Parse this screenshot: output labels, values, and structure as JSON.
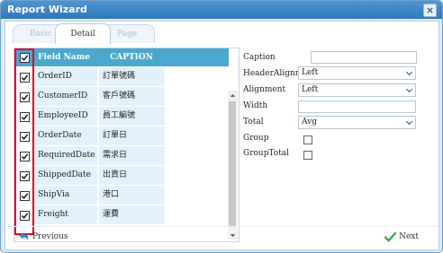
{
  "window": {
    "title": "Report Wizard"
  },
  "tabs": [
    {
      "label": "Basic",
      "active": false
    },
    {
      "label": "Detail",
      "active": true
    },
    {
      "label": "Page",
      "active": false
    }
  ],
  "grid": {
    "columns": [
      "Field Name",
      "CAPTION"
    ],
    "rows": [
      {
        "field": "OrderID",
        "caption": "訂單號碼",
        "checked": true
      },
      {
        "field": "CustomerID",
        "caption": "客戶號碼",
        "checked": true
      },
      {
        "field": "EmployeeID",
        "caption": "員工編號",
        "checked": true
      },
      {
        "field": "OrderDate",
        "caption": "訂單日",
        "checked": true
      },
      {
        "field": "RequiredDate",
        "caption": "需求日",
        "checked": true
      },
      {
        "field": "ShippedDate",
        "caption": "出貨日",
        "checked": true
      },
      {
        "field": "ShipVia",
        "caption": "港口",
        "checked": true
      },
      {
        "field": "Freight",
        "caption": "運費",
        "checked": true
      }
    ]
  },
  "properties": {
    "caption_label": "Caption",
    "header_alignment_label": "HeaderAlignment",
    "header_alignment_value": "Left",
    "alignment_label": "Alignment",
    "alignment_value": "Left",
    "width_label": "Width",
    "total_label": "Total",
    "total_value": "Avg",
    "group_label": "Group",
    "group_total_label": "GroupTotal"
  },
  "footer": {
    "previous_label": "Previous",
    "next_label": "Next"
  },
  "colors": {
    "titlebar": "#3b84c4",
    "grid_header": "#4aa8cf",
    "row_fill": "#e3f2fa",
    "highlight": "#e0001b",
    "next_check": "#48a948"
  }
}
